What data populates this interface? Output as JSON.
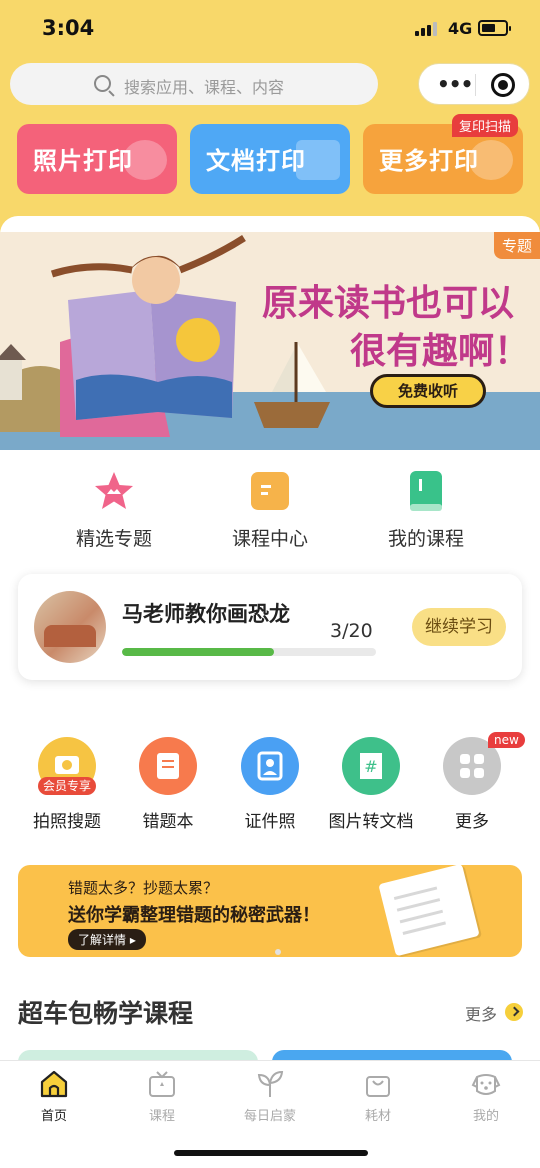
{
  "status_bar": {
    "time": "3:04",
    "network": "4G"
  },
  "search": {
    "placeholder": "搜索应用、课程、内容"
  },
  "print_cards": [
    {
      "label": "照片打印",
      "color": "#f4627a"
    },
    {
      "label": "文档打印",
      "color": "#4fa8f5"
    },
    {
      "label": "更多打印",
      "color": "#f6a33d"
    }
  ],
  "print_badge": "复印扫描",
  "banner": {
    "tag": "专题",
    "title_line1": "原来读书也可以",
    "title_line2": "很有趣啊！",
    "button": "免费收听"
  },
  "nav": [
    {
      "label": "精选专题",
      "icon": "star-icon"
    },
    {
      "label": "课程中心",
      "icon": "folder-icon"
    },
    {
      "label": "我的课程",
      "icon": "book-icon"
    }
  ],
  "course": {
    "title": "马老师教你画恐龙",
    "progress_text": "3/20",
    "progress": 0.6,
    "button": "继续学习"
  },
  "tools": [
    {
      "label": "拍照搜题",
      "icon": "camera-icon",
      "badge": "会员专享",
      "color": "#f6c443"
    },
    {
      "label": "错题本",
      "icon": "notebook-icon",
      "color": "#f77a4d"
    },
    {
      "label": "证件照",
      "icon": "id-photo-icon",
      "color": "#4aa0f3"
    },
    {
      "label": "图片转文档",
      "icon": "image-to-doc-icon",
      "color": "#3ec08a"
    },
    {
      "label": "更多",
      "icon": "grid-icon",
      "color": "#c8c8c8"
    }
  ],
  "tools_new_badge": "new",
  "promo": {
    "line1": "错题太多？抄题太累？",
    "line2": "送你学霸整理错题的秘密武器！",
    "button": "了解详情 ▸"
  },
  "section": {
    "title": "超车包畅学课程",
    "more": "更多"
  },
  "tabs": [
    {
      "label": "首页",
      "icon": "home-icon",
      "active": true
    },
    {
      "label": "课程",
      "icon": "tv-icon"
    },
    {
      "label": "每日启蒙",
      "icon": "sprout-icon"
    },
    {
      "label": "耗材",
      "icon": "bag-icon"
    },
    {
      "label": "我的",
      "icon": "dog-face-icon"
    }
  ]
}
